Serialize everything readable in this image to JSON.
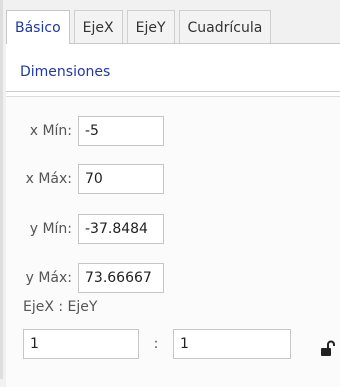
{
  "tabs": [
    {
      "label": "Básico",
      "active": true
    },
    {
      "label": "EjeX",
      "active": false
    },
    {
      "label": "EjeY",
      "active": false
    },
    {
      "label": "Cuadrícula",
      "active": false
    }
  ],
  "section": {
    "title": "Dimensiones"
  },
  "fields": {
    "x_min": {
      "label": "x Mín:",
      "value": "-5"
    },
    "x_max": {
      "label": "x Máx:",
      "value": "70"
    },
    "y_min": {
      "label": "y Mín:",
      "value": "-37.8484"
    },
    "y_max": {
      "label": "y Máx:",
      "value": "73.66667"
    }
  },
  "ratio": {
    "label": "EjeX : EjeY",
    "x_value": "1",
    "separator": ":",
    "y_value": "1",
    "lock_icon": "unlocked-padlock-icon"
  },
  "colors": {
    "accent": "#1f38a8"
  }
}
